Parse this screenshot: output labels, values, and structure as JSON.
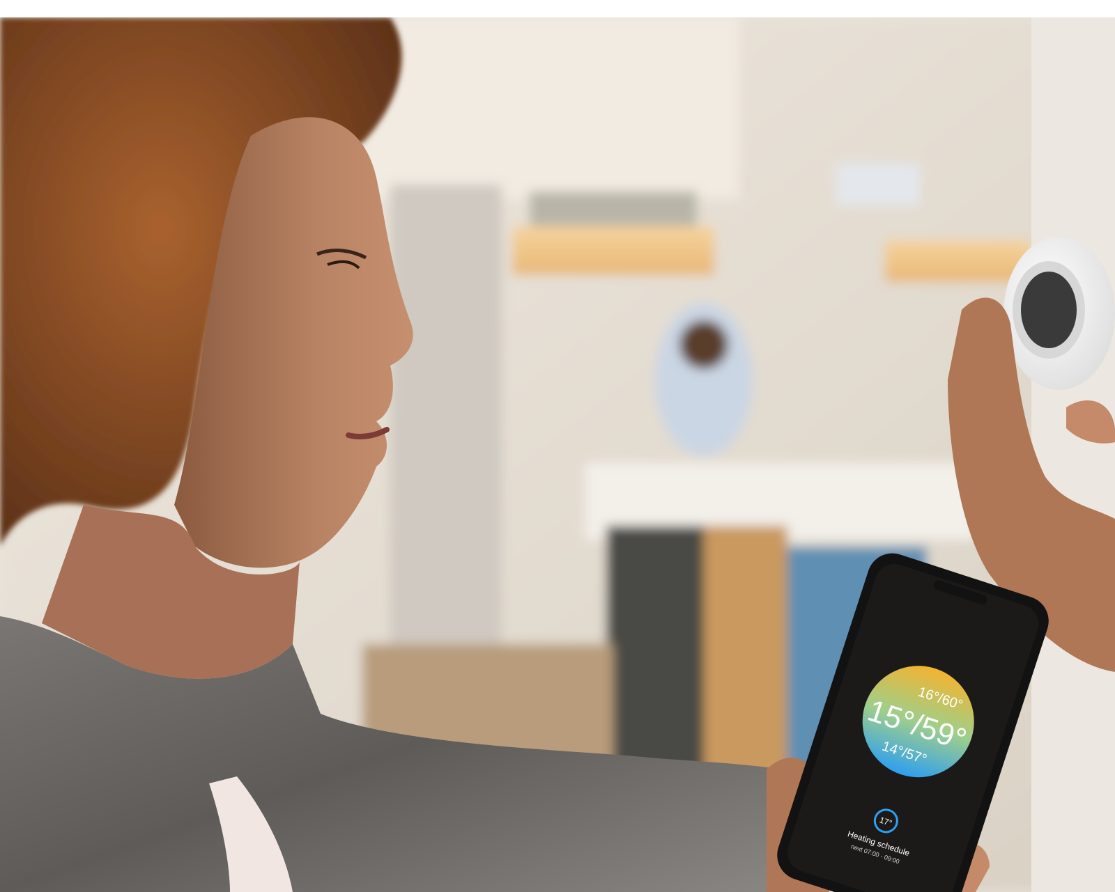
{
  "photo": {
    "subject": "woman adjusting wall thermostat while holding smartphone",
    "palette": {
      "background_wall": "#e9e3da",
      "kitchen_warm_light": "#f2c58a",
      "counter_top": "#f3efe9",
      "cabinet_dark": "#4a4845",
      "cabinet_wood": "#c9995e",
      "cabinet_blue": "#5f8fb3",
      "skin": "#b07756",
      "hair": "#8a4e28",
      "sweater": "#6f6c69",
      "phone_body": "#121212",
      "thermostat_body": "#f6f6f6",
      "thermostat_screen": "#3a3a3a"
    }
  },
  "phone_app": {
    "dial_colors": {
      "top": "#f3b330",
      "middle": "#9fcf8a",
      "bottom": "#2f9ff0"
    },
    "upper_setpoint": "16°/60°",
    "current_temperature": "15°/59°",
    "lower_setpoint": "14°/57°",
    "schedule_badge": "17°",
    "schedule_label": "Heating schedule",
    "schedule_time": "next 07:00 - 09:00"
  }
}
